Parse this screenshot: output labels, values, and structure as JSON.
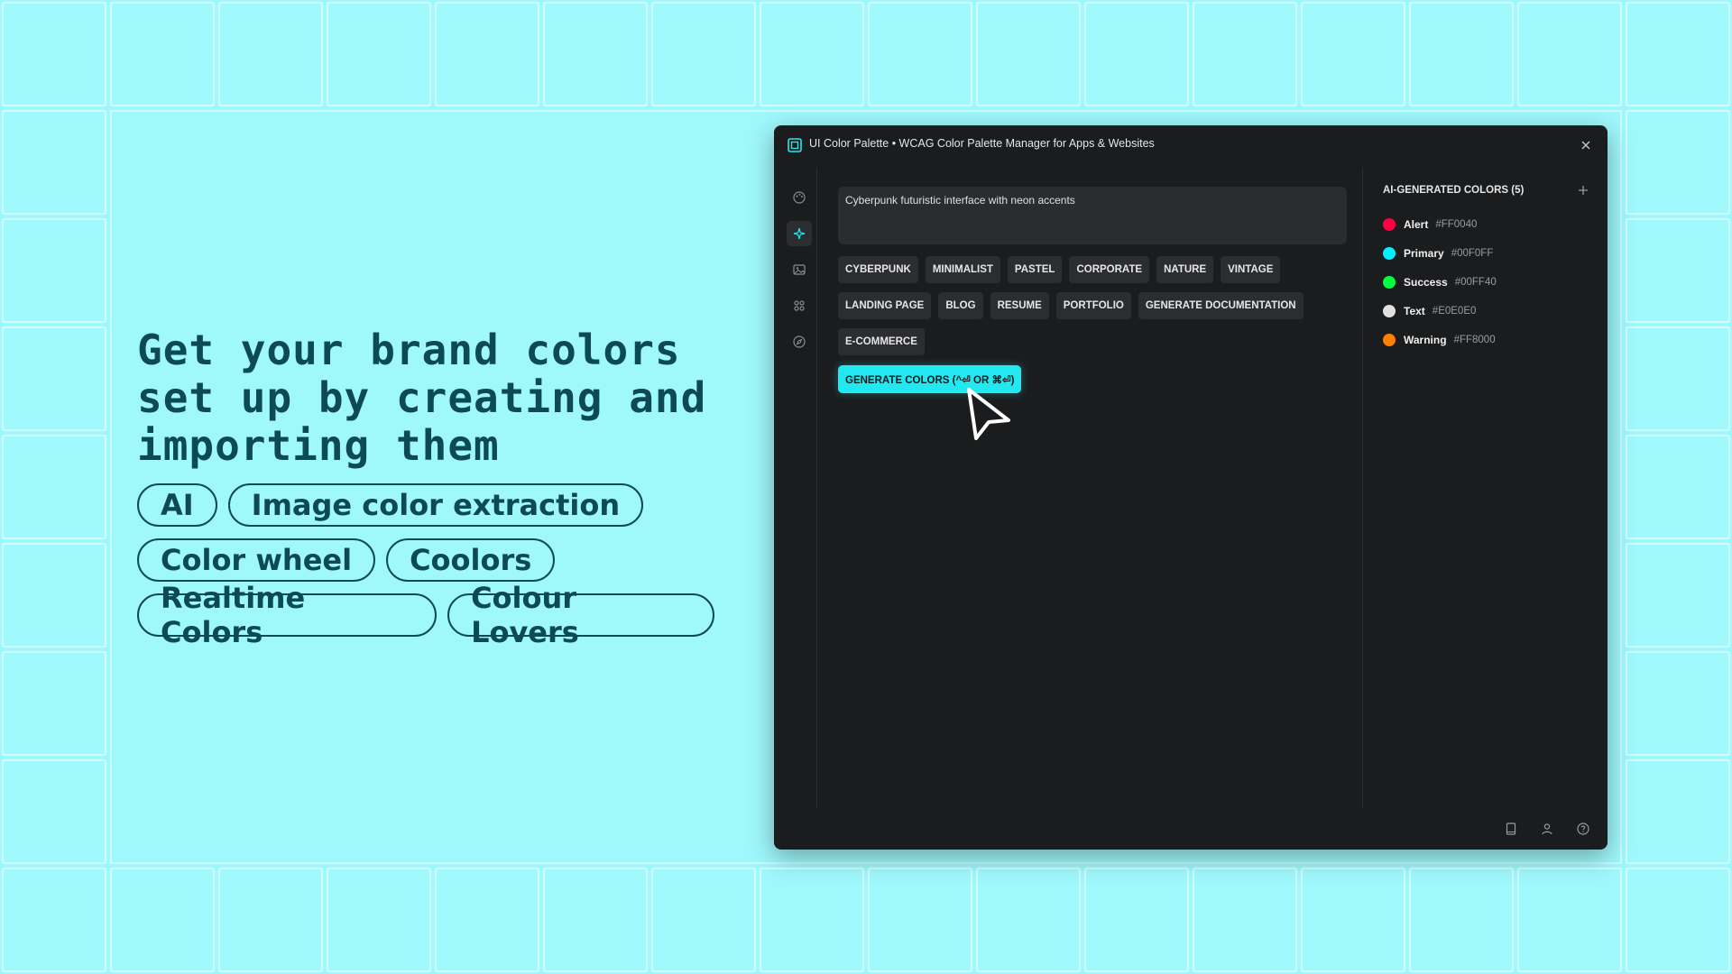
{
  "marketing": {
    "headline": "Get your brand colors set up by creating and importing them",
    "pills": [
      [
        "AI",
        "Image color extraction"
      ],
      [
        "Color wheel",
        "Coolors"
      ],
      [
        "Realtime Colors",
        "Colour Lovers"
      ]
    ]
  },
  "window": {
    "title": "UI Color Palette • WCAG Color Palette Manager for Apps & Websites",
    "icons": {
      "app": "palette-app-icon",
      "close": "close-icon",
      "nav": [
        "palette-icon",
        "sparkle-icon",
        "image-icon",
        "grid-icon",
        "compass-icon"
      ],
      "footer": [
        "book-icon",
        "user-icon",
        "help-icon"
      ]
    }
  },
  "generator": {
    "prompt_value": "Cyberpunk futuristic interface with neon accents",
    "chip_rows": [
      [
        "CYBERPUNK",
        "MINIMALIST",
        "PASTEL",
        "CORPORATE",
        "NATURE",
        "VINTAGE"
      ],
      [
        "LANDING PAGE",
        "BLOG",
        "RESUME",
        "PORTFOLIO",
        "GENERATE DOCUMENTATION"
      ],
      [
        "E-COMMERCE"
      ]
    ],
    "generate_label": "GENERATE COLORS (^⏎ OR ⌘⏎)"
  },
  "colors_panel": {
    "header": "AI-GENERATED COLORS (5)",
    "items": [
      {
        "name": "Alert",
        "hex": "#FF0040",
        "swatch": "#ff0040"
      },
      {
        "name": "Primary",
        "hex": "#00F0FF",
        "swatch": "#00f0ff"
      },
      {
        "name": "Success",
        "hex": "#00FF40",
        "swatch": "#00ff40"
      },
      {
        "name": "Text",
        "hex": "#E0E0E0",
        "swatch": "#e0e0e0"
      },
      {
        "name": "Warning",
        "hex": "#FF8000",
        "swatch": "#ff8000"
      }
    ]
  },
  "theme": {
    "background": "#9ff8fc",
    "window_bg": "#1b1c1e",
    "accent": "#22e9f0",
    "headline_color": "#0d4a55"
  }
}
